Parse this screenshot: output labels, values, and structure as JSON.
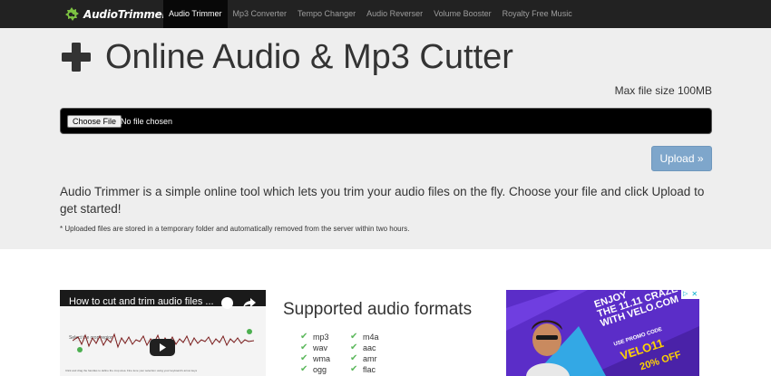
{
  "brand": {
    "name": "AudioTrimmer"
  },
  "nav": {
    "items": [
      {
        "label": "Audio Trimmer",
        "active": true
      },
      {
        "label": "Mp3 Converter",
        "active": false
      },
      {
        "label": "Tempo Changer",
        "active": false
      },
      {
        "label": "Audio Reverser",
        "active": false
      },
      {
        "label": "Volume Booster",
        "active": false
      },
      {
        "label": "Royalty Free Music",
        "active": false
      }
    ]
  },
  "hero": {
    "title": "Online Audio & Mp3 Cutter",
    "max_size": "Max file size 100MB",
    "file_button": "Choose File",
    "file_status": "No file chosen",
    "upload_label": "Upload »",
    "description": "Audio Trimmer is a simple online tool which lets you trim your audio files on the fly. Choose your file and click Upload to get started!",
    "note": "* Uploaded files are stored in a temporary folder and automatically removed from the server within two hours."
  },
  "video": {
    "title": "How to cut and trim audio files ...",
    "subtitle": "Select the crop region",
    "caption": "Click and drag the handles to define the crop area. Fine tune your selection using your keyboard's arrow keys"
  },
  "formats": {
    "title": "Supported audio formats",
    "col1": [
      "mp3",
      "wav",
      "wma",
      "ogg"
    ],
    "col2": [
      "m4a",
      "aac",
      "amr",
      "flac"
    ]
  },
  "ad": {
    "lines": [
      "ENJOY",
      "THE 11.11 CRAZE",
      "WITH VELO.COM"
    ],
    "promo": "USE PROMO CODE",
    "code": "VELO11",
    "offer": "20% OFF"
  },
  "colors": {
    "navbar": "#222222",
    "jumbotron": "#eeeeee",
    "upload": "#7ea6cb",
    "check": "#5cb85c",
    "ad_bg": "#5b2dc8"
  }
}
